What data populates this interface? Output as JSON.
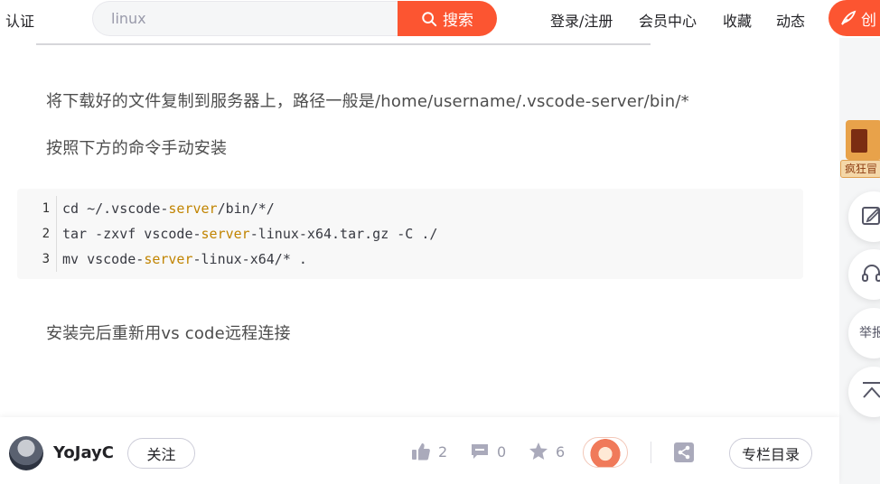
{
  "header": {
    "left_text": "认证",
    "search": {
      "value": "linux",
      "button_label": "搜索"
    },
    "links": [
      "登录/注册",
      "会员中心",
      "收藏",
      "动态"
    ],
    "create_label": "创"
  },
  "article": {
    "paragraph_1": "将下载好的文件复制到服务器上，路径一般是/home/username/.vscode-server/bin/*",
    "paragraph_2": "按照下方的命令手动安装",
    "code": [
      {
        "num": "1",
        "pre": "cd ~/.vscode-",
        "kw": "server",
        "post": "/bin/*/"
      },
      {
        "num": "2",
        "pre": "tar -zxvf vscode-",
        "kw": "server",
        "post": "-linux-x64.tar.gz -C ./"
      },
      {
        "num": "3",
        "pre": "mv vscode-",
        "kw": "server",
        "post": "-linux-x64/* ."
      }
    ],
    "paragraph_3": "安装完后重新用vs code远程连接"
  },
  "sidebar": {
    "promo_label": "疯狂冒",
    "report_label": "举报"
  },
  "bottom_bar": {
    "author": "YoJayC",
    "follow_label": "关注",
    "likes": "2",
    "comments": "0",
    "favorites": "6",
    "toc_label": "专栏目录"
  },
  "colors": {
    "accent": "#fc5531",
    "code_keyword": "#c18401",
    "code_background": "#f8f8f8"
  },
  "icons": [
    "search-icon",
    "pen-icon",
    "edit-icon",
    "headset-icon",
    "back-to-top-icon",
    "like-icon",
    "comment-icon",
    "favorite-icon",
    "share-icon"
  ]
}
